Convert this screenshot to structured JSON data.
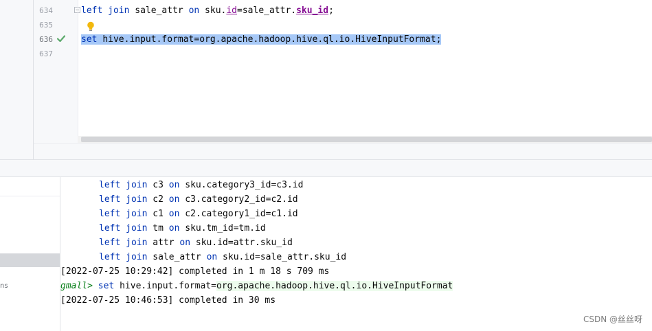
{
  "editor": {
    "line_numbers": [
      "634",
      "635",
      "636",
      "637"
    ],
    "line_634": {
      "kw_left": "left",
      "kw_join": "join",
      "table": "sale_attr",
      "kw_on": "on",
      "ref_prefix": "sku.",
      "ref_field": "id",
      "eq_prefix": "=sale_attr.",
      "eq_field": "sku_id",
      "end": ";"
    },
    "line_636": {
      "kw_set": "set",
      "value": "hive.input.format=org.apache.hadoop.hive.ql.io.HiveInputFormat;"
    }
  },
  "console": {
    "lines": [
      {
        "kw1": "left",
        "kw2": "join",
        "table": "c3",
        "kw3": "on",
        "cond": "sku.category3_id=c3.id"
      },
      {
        "kw1": "left",
        "kw2": "join",
        "table": "c2",
        "kw3": "on",
        "cond": "c3.category2_id=c2.id"
      },
      {
        "kw1": "left",
        "kw2": "join",
        "table": "c1",
        "kw3": "on",
        "cond": "c2.category1_id=c1.id"
      },
      {
        "kw1": "left",
        "kw2": "join",
        "table": "tm",
        "kw3": "on",
        "cond": "sku.tm_id=tm.id"
      },
      {
        "kw1": "left",
        "kw2": "join",
        "table": "attr",
        "kw3": "on",
        "cond": "sku.id=attr.sku_id"
      },
      {
        "kw1": "left",
        "kw2": "join",
        "table": "sale_attr",
        "kw3": "on",
        "cond": "sku.id=sale_attr.sku_id"
      }
    ],
    "status_1": "[2022-07-25 10:29:42] completed in 1 m 18 s 709 ms",
    "prompt": "gmall>",
    "prompt_cmd_kw": "set",
    "prompt_cmd_key": "hive.input.format=",
    "prompt_cmd_value": "org.apache.hadoop.hive.ql.io.HiveInputFormat",
    "status_2": "[2022-07-25 10:46:53] completed in 30 ms"
  },
  "sidebar": {
    "label": "ns"
  },
  "watermark": "CSDN @丝丝呀",
  "colors": {
    "keyword": "#0033b3",
    "field": "#871094",
    "selection": "#a6c8f7",
    "prompt": "#067d17",
    "check": "#59a869",
    "bulb": "#f2b80c"
  },
  "icons": {
    "check": "check-icon",
    "bulb": "lightbulb-icon",
    "fold": "fold-icon"
  }
}
